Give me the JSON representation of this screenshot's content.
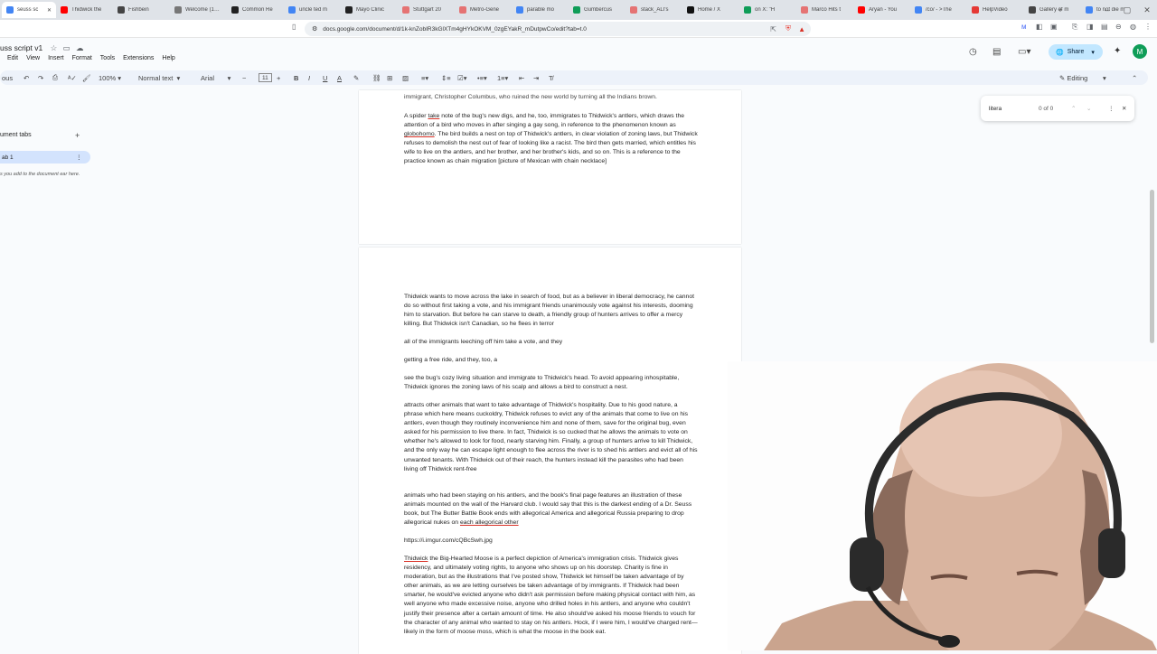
{
  "browser": {
    "tabs": [
      {
        "label": "seuss sc",
        "color": "#4285f4",
        "active": true
      },
      {
        "label": "Thidwick the",
        "color": "#ff0000"
      },
      {
        "label": "Fishbein",
        "color": "#444444"
      },
      {
        "label": "Welcome (1…",
        "color": "#777777"
      },
      {
        "label": "Common Re",
        "color": "#222222"
      },
      {
        "label": "uncle ted m",
        "color": "#4285f4"
      },
      {
        "label": "Mayo Clinic",
        "color": "#222222"
      },
      {
        "label": "Stuttgart 20",
        "color": "#e57373"
      },
      {
        "label": "Metro-Gene",
        "color": "#e57373"
      },
      {
        "label": "parable mo",
        "color": "#4285f4"
      },
      {
        "label": "Gumbercus",
        "color": "#0f9d58"
      },
      {
        "label": "stack_ALI's",
        "color": "#e57373"
      },
      {
        "label": "Home / X",
        "color": "#111111"
      },
      {
        "label": "on X: \"H",
        "color": "#0f9d58"
      },
      {
        "label": "Marco Hits t",
        "color": "#e57373"
      },
      {
        "label": "Aryan - You",
        "color": "#ff0000"
      },
      {
        "label": "/co/ - >The",
        "color": "#4285f4"
      },
      {
        "label": "HelpVideo",
        "color": "#e53935"
      },
      {
        "label": "Gallery of m",
        "color": "#444444"
      },
      {
        "label": "to not die m",
        "color": "#4285f4"
      }
    ],
    "url": "docs.google.com/document/d/1k-knZobIR3kGlXTm4gHYkOKVM_0zgEYakR_mDutpwCo/edit?tab=t.0"
  },
  "doc": {
    "title": "uss script v1",
    "menu": [
      "Edit",
      "View",
      "Insert",
      "Format",
      "Tools",
      "Extensions",
      "Help"
    ],
    "toolbar": {
      "zoom": "100%",
      "style": "Normal text",
      "font": "Arial",
      "size": "11",
      "mode_label": "Editing",
      "share_label": "Share",
      "mode_prefix": "ous"
    },
    "account_initial": "M"
  },
  "sidebar": {
    "heading": "ument tabs",
    "tab_label": "ab 1",
    "note": "s you add to the document ear here."
  },
  "find": {
    "query": "litera",
    "count": "0 of 0"
  },
  "page1": {
    "top_line": "immigrant, Christopher Columbus, who ruined the new world by turning all the Indians brown.",
    "p1": "A spider ",
    "p1_link": "take",
    "p1b": " note of the bug's new digs, and he, too, immigrates to Thidwick's antlers, which draws the attention of a bird who moves in after singing a gay song, in reference to the phenomenon known as ",
    "p1_link2": "globohomo",
    "p1c": ". The bird builds a nest on top of Thidwick's antlers, in clear violation of zoning laws, but Thidwick refuses to demolish the nest out of fear of looking like a racist. The bird then gets married, which entitles his wife to live on the antlers, and her brother, and her brother's kids, and so on. This is a reference to the practice known as chain migration [picture of Mexican with chain necklace]"
  },
  "page2": {
    "p1": "Thidwick wants to move across the lake in search of food, but as a believer in liberal democracy, he cannot do so without first taking a vote, and his immigrant friends unanimously vote against his interests, dooming him to starvation. But before he can starve to death, a friendly group of hunters arrives to offer a mercy killing. But Thidwick isn't Canadian, so he flees in terror",
    "p2": "all of the immigrants leeching off him take a vote, and they",
    "p3": "getting a free ride, and they, too, a",
    "p4": "see the bug's cozy living situation and immigrate to Thidwick's head. To avoid appearing inhospitable, Thidwick ignores the zoning laws of his scalp and allows a bird to construct a nest.",
    "p5": " attracts other animals that want to take advantage of Thidwick's hospitality.  Due to his good nature, a phrase which here means cuckoldry, Thidwick refuses to evict any of the animals that come to live on his antlers, even though they routinely inconvenience him and none of them, save for the original bug, even asked for his permission to live there.  In fact, Thidwick is so cucked that he allows the animals to vote on whether he's allowed to look for food, nearly starving him.  Finally, a group of hunters arrive to kill Thidwick, and the only way he can escape light enough to flee across the river is to shed his antlers and evict all of his unwanted tenants.  With Thidwick out of their reach, the hunters instead kill the parasites who had been living off Thidwick rent-free",
    "p6": " animals who had been staying on his antlers, and the book's final page features an illustration of these animals mounted on the wall of the Harvard club.  I would say that this is the darkest ending of a Dr. Seuss book, but The Butter Battle Book ends with allegorical America and allegorical Russia preparing to drop allegorical nukes on ",
    "p6_link": "each allegorical other",
    "p7": "https://i.imgur.com/cQBcSwh.jpg",
    "p8_link": "Thidwick",
    "p8": " the Big-Hearted Moose is a perfect depiction of America's immigration crisis.  Thidwick gives residency, and ultimately voting rights, to anyone who shows up on his doorstep.  Charity is fine in moderation, but as the illustrations that I've posted show, Thidwick let himself be taken advantage of by other animals, as we are letting ourselves be taken advantage of by immigrants.  If Thidwick had been smarter, he would've evicted anyone who didn't ask permission before making physical contact with him, as well anyone who made excessive noise, anyone who drilled holes in his antlers, and anyone who couldn't justify their presence after a certain amount of time.  He also should've asked his moose friends to vouch for the character of any animal who wanted to stay on his antlers.  Hock, if I were him, I would've charged rent—likely in the form of moose moss, which is what the moose in the book eat."
  },
  "colors": {
    "accent": "#c2e7ff",
    "brand": "#1a73e8",
    "tab_active_bg": "#d3e3fd"
  }
}
